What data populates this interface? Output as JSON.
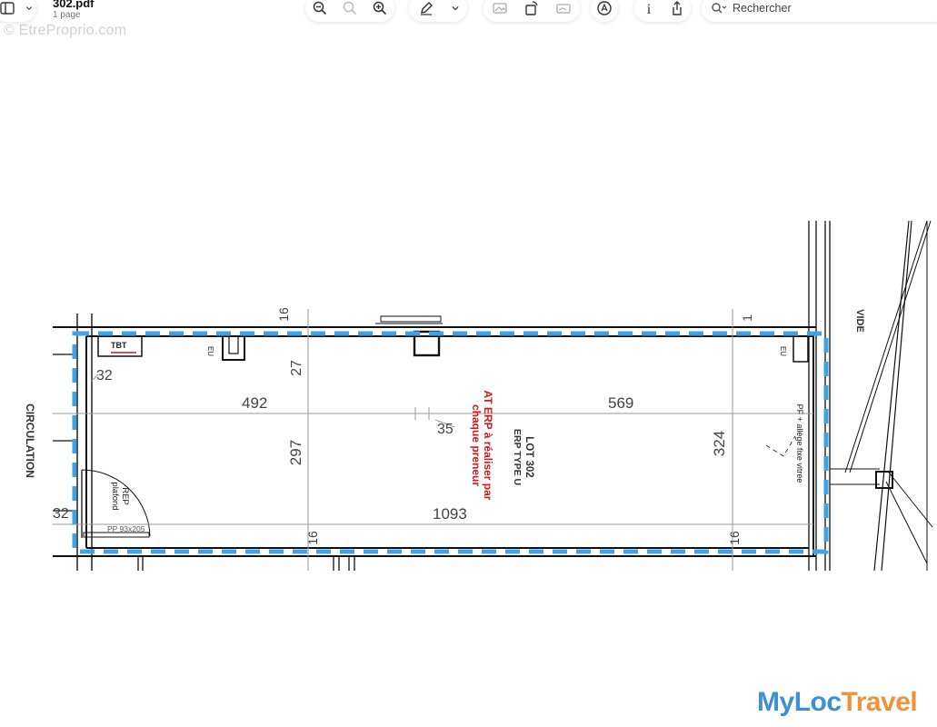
{
  "document": {
    "filename": "302.pdf",
    "pages": "1 page"
  },
  "watermark": "© EtreProprio.com",
  "toolbar": {
    "sidebar_icon": "sidebar-icon",
    "zoom_out_icon": "zoom-out-icon",
    "zoom_fit_icon": "zoom-fit-icon",
    "zoom_in_icon": "zoom-in-icon",
    "markup_icon": "pen-icon",
    "markup_menu_icon": "chevron-down-icon",
    "crop_icon": "crop-icon",
    "rotate_icon": "rotate-icon",
    "redact_icon": "redact-icon",
    "signature_icon": "signature-icon",
    "info_icon": "info-icon",
    "share_icon": "share-icon",
    "search_placeholder": "Rechercher"
  },
  "plan": {
    "circulation": "CIRCULATION",
    "vide": "VIDE",
    "lot_title": "LOT 302",
    "erp_type": "ERP TYPE U",
    "notice_line1": "AT ERP à réaliser par",
    "notice_line2": "chaque preneur",
    "notice_color": "#d4161b",
    "outline_color": "#3fa3e8",
    "tbt": "TBT",
    "eu_left": "EU",
    "eu_right": "EU",
    "rep_line1": "REP",
    "rep_line2": "plafond",
    "door": "PP 93x205",
    "window_line1": "PF + allège fixe vitrée",
    "dim_492": "492",
    "dim_569": "569",
    "dim_1093": "1093",
    "dim_297": "297",
    "dim_324": "324",
    "dim_27": "27",
    "dim_35": "35",
    "dim_32_top": "32",
    "dim_32_left": "32",
    "dim_16_top_left": "16",
    "dim_16_top_right": "1",
    "dim_16_bot_left": "16",
    "dim_16_bot_right": "16"
  },
  "branding": {
    "part1": "My",
    "part2": "Loc",
    "part3": "Travel"
  }
}
